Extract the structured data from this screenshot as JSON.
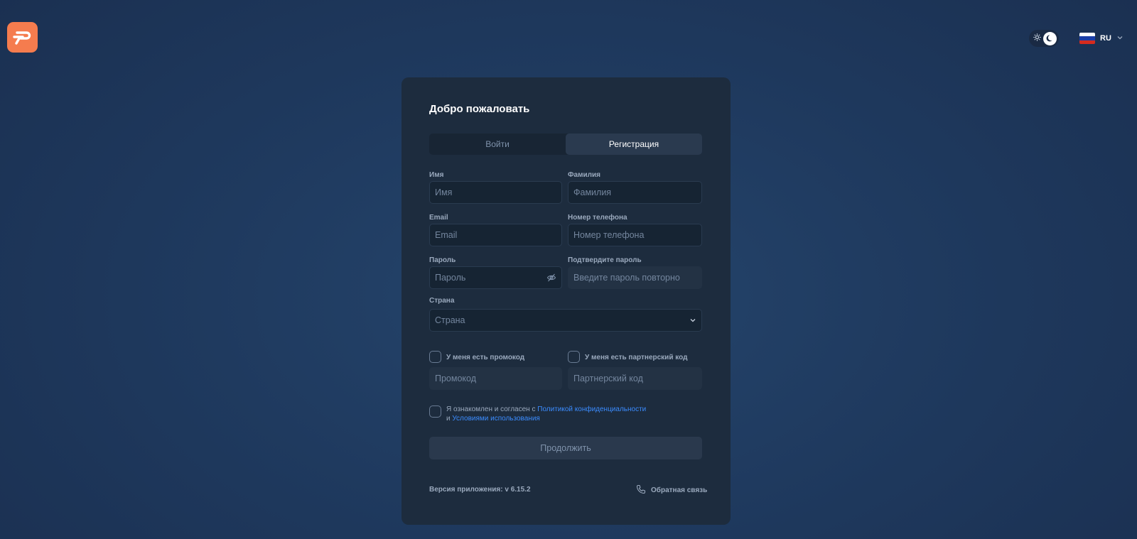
{
  "header": {
    "logo_icon": "brand-logo-icon",
    "theme_icons": [
      "sun-icon",
      "moon-icon"
    ],
    "language": {
      "code": "RU",
      "flag_colors": [
        "#ffffff",
        "#1c3fa8",
        "#d52b1e"
      ]
    }
  },
  "card": {
    "title": "Добро пожаловать",
    "tabs": [
      {
        "label": "Войти",
        "active": false
      },
      {
        "label": "Регистрация",
        "active": true
      }
    ],
    "fields": {
      "first_name": {
        "label": "Имя",
        "placeholder": "Имя"
      },
      "last_name": {
        "label": "Фамилия",
        "placeholder": "Фамилия"
      },
      "email": {
        "label": "Email",
        "placeholder": "Email"
      },
      "phone": {
        "label": "Номер телефона",
        "placeholder": "Номер телефона"
      },
      "password": {
        "label": "Пароль",
        "placeholder": "Пароль"
      },
      "confirm_password": {
        "label": "Подтвердите пароль",
        "placeholder": "Введите пароль повторно"
      },
      "country": {
        "label": "Страна",
        "placeholder": "Страна"
      }
    },
    "checks": {
      "promo": {
        "label": "У меня есть промокод",
        "placeholder": "Промокод"
      },
      "partner": {
        "label": "У меня есть партнерский код",
        "placeholder": "Партнерский код"
      }
    },
    "agreement": {
      "text_before": "Я ознакомлен и согласен с ",
      "privacy_link": "Политикой конфиденциальности",
      "text_and": "и ",
      "terms_link": "Условиями использования"
    },
    "submit_label": "Продолжить",
    "version": "Версия приложения: v 6.15.2",
    "feedback_label": "Обратная связь"
  },
  "colors": {
    "accent": "#f57c4e",
    "link": "#3b8cff",
    "card_bg": "#1d2c3e"
  }
}
